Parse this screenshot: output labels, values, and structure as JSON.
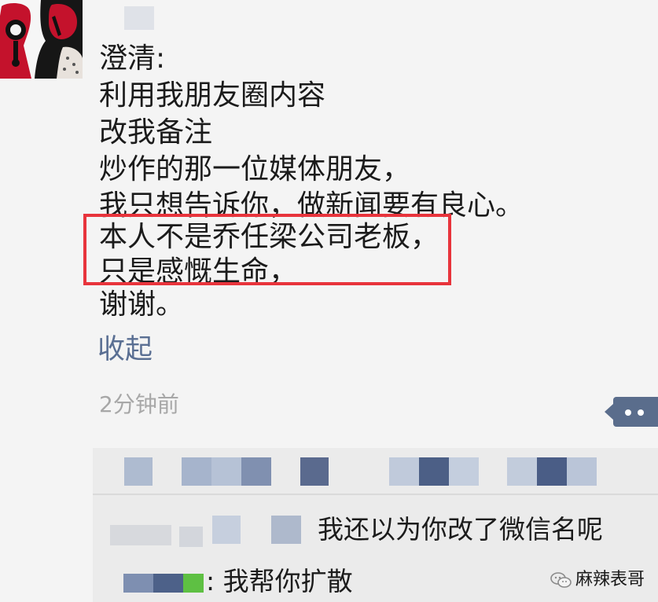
{
  "post": {
    "lines": [
      "澄清:",
      "利用我朋友圈内容",
      "改我备注",
      "炒作的那一位媒体朋友，",
      "我只想告诉你，做新闻要有良心。",
      "本人不是乔任梁公司老板，",
      "只是感慨生命，",
      "谢谢。"
    ],
    "collapse_label": "收起",
    "timestamp": "2分钟前"
  },
  "comments": [
    {
      "text": "我还以为你改了微信名呢"
    },
    {
      "text": ": 我帮你扩散"
    }
  ],
  "watermark": {
    "text": "麻辣表哥"
  },
  "colors": {
    "highlight": "#e8343c",
    "link": "#5a6f93",
    "timestamp": "#a7a7a7",
    "more_button": "#5a6d8c",
    "blur_dark": "#4c5f86",
    "blur_light": "#aebbd0"
  }
}
